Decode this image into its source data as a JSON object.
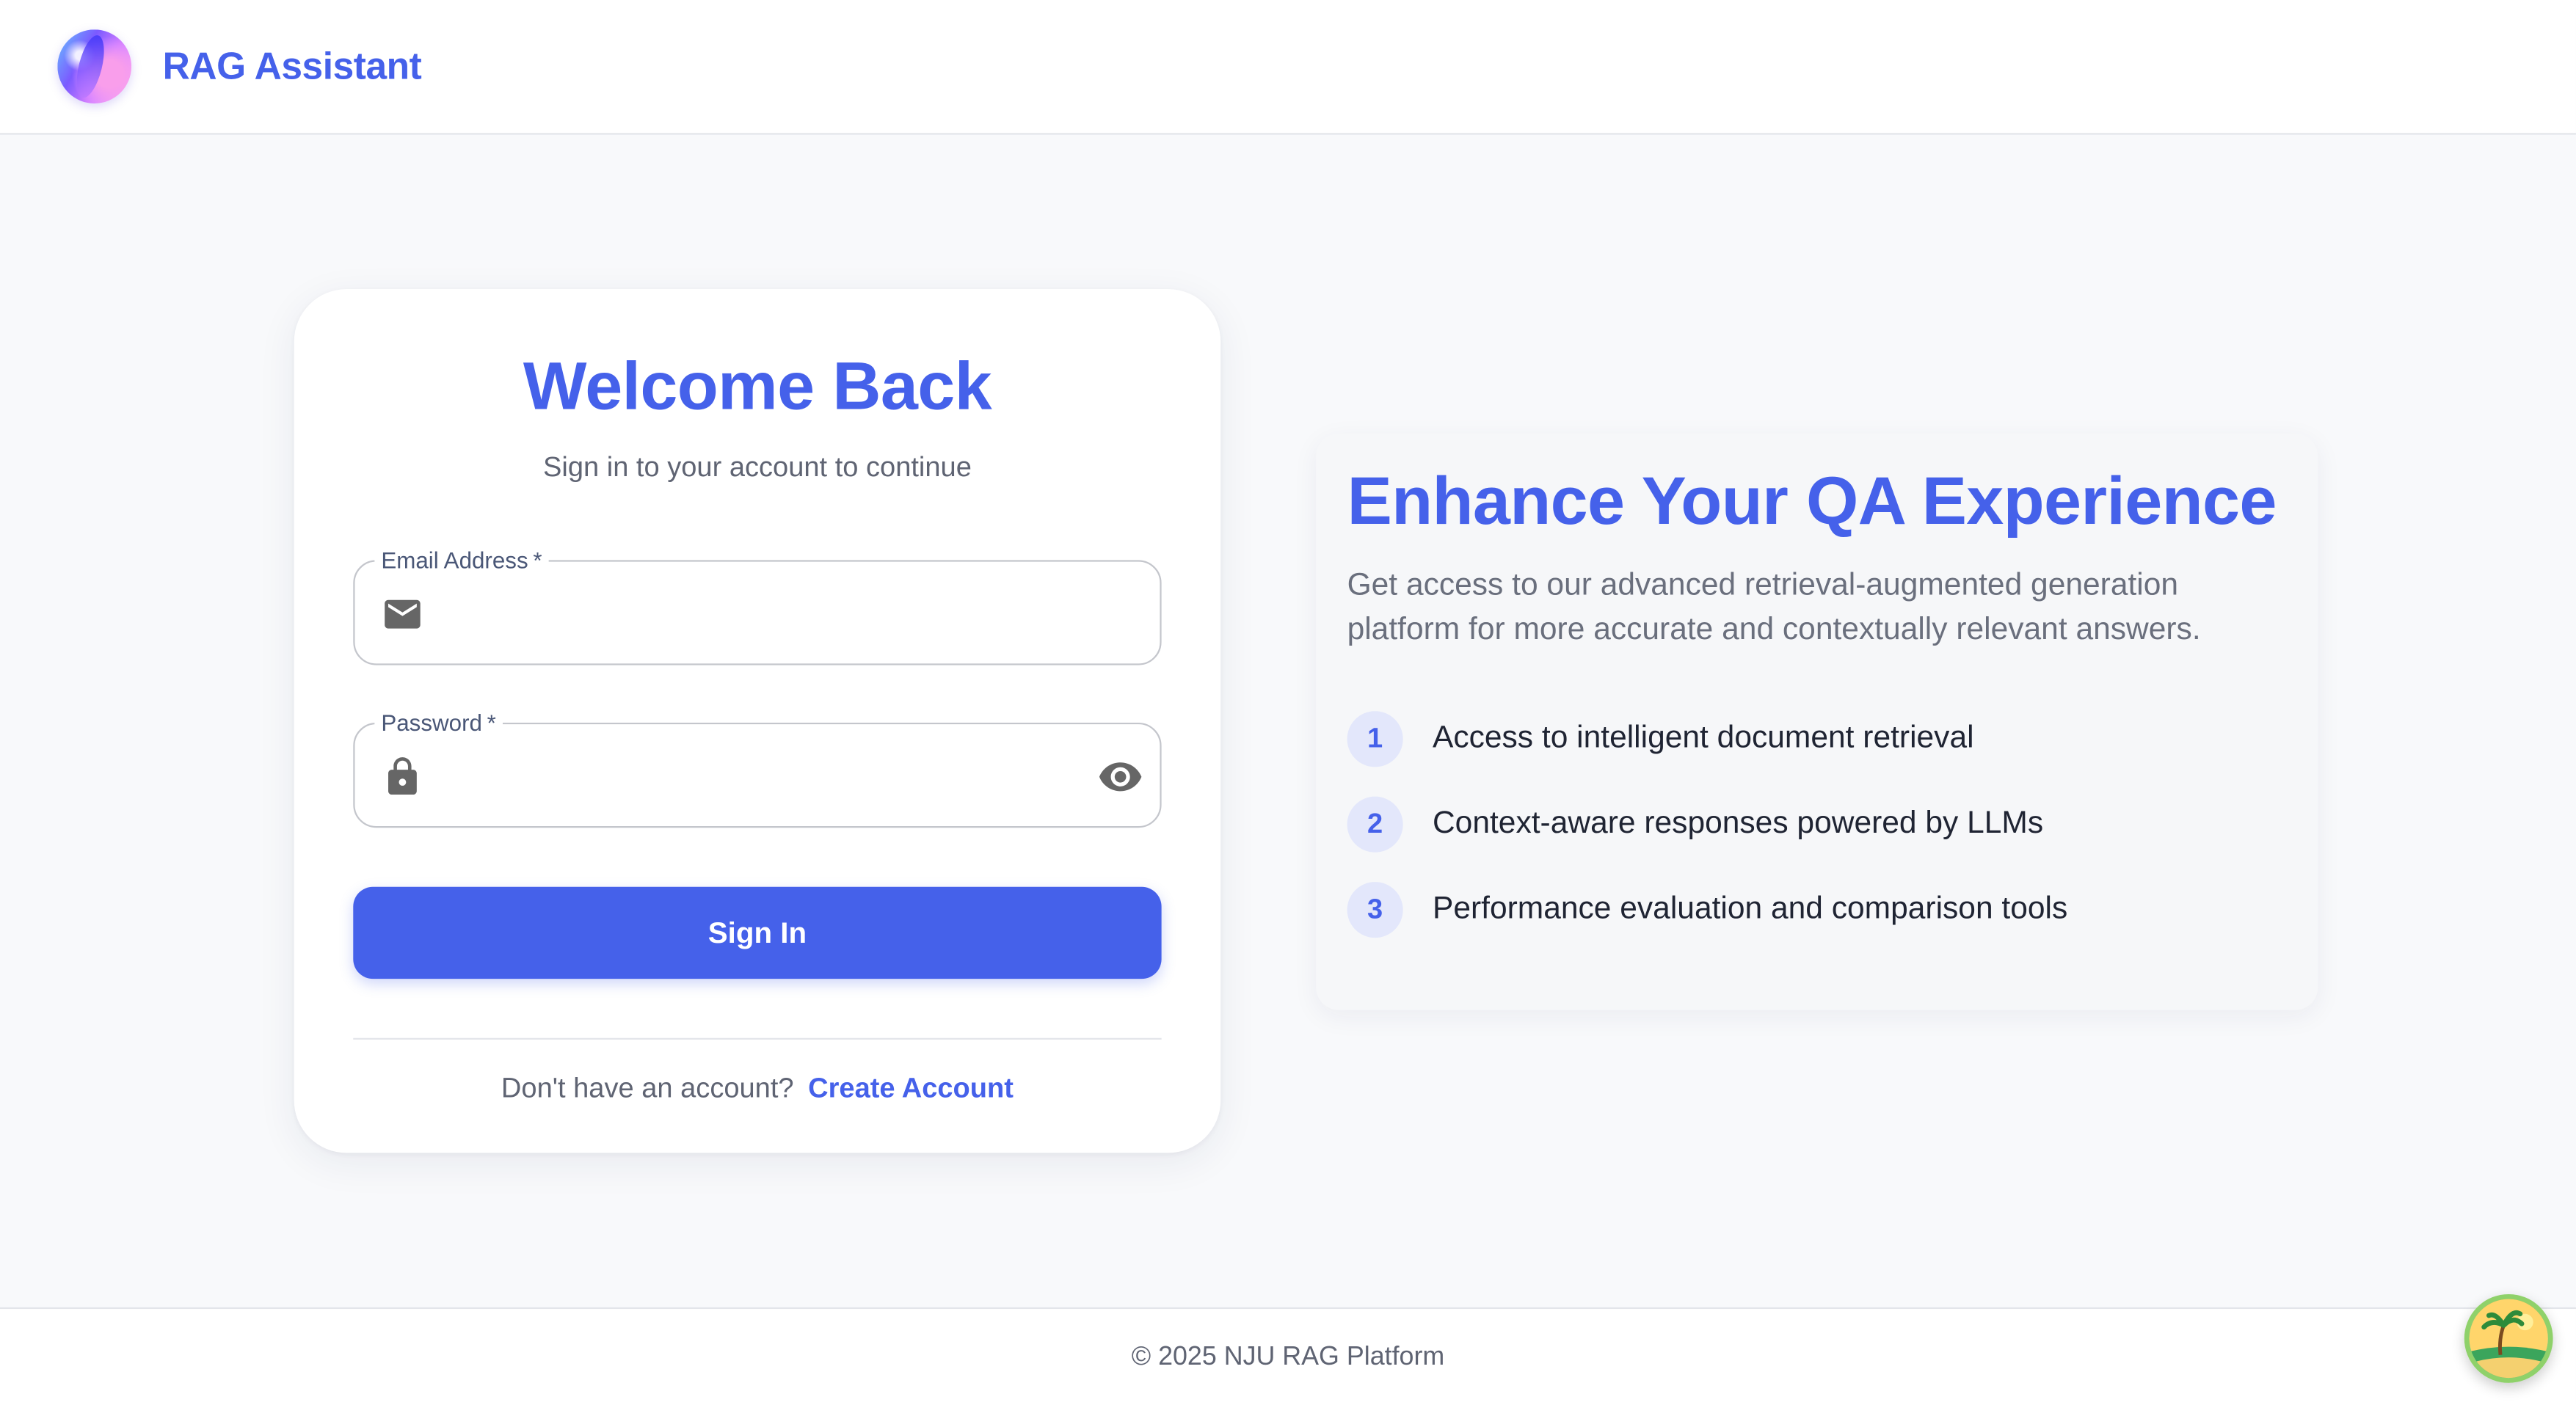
{
  "header": {
    "app_title": "RAG Assistant"
  },
  "login": {
    "title": "Welcome Back",
    "subtitle": "Sign in to your account to continue",
    "email": {
      "label": "Email Address",
      "required_mark": "*",
      "value": "",
      "icon": "mail-icon"
    },
    "password": {
      "label": "Password",
      "required_mark": "*",
      "value": "",
      "icon": "lock-icon",
      "toggle_icon": "eye-icon"
    },
    "sign_in_label": "Sign In",
    "signup_prompt": "Don't have an account?",
    "signup_link": "Create Account"
  },
  "promo": {
    "title": "Enhance Your QA Experience",
    "description": "Get access to our advanced retrieval-augmented generation platform for more accurate and contextually relevant answers.",
    "features": [
      {
        "num": "1",
        "text": "Access to intelligent document retrieval"
      },
      {
        "num": "2",
        "text": "Context-aware responses powered by LLMs"
      },
      {
        "num": "3",
        "text": "Performance evaluation and comparison tools"
      }
    ]
  },
  "footer": {
    "text": "© 2025 NJU RAG Platform"
  },
  "colors": {
    "brand": "#4561ea",
    "background": "#f8f9fb",
    "card": "#ffffff"
  }
}
